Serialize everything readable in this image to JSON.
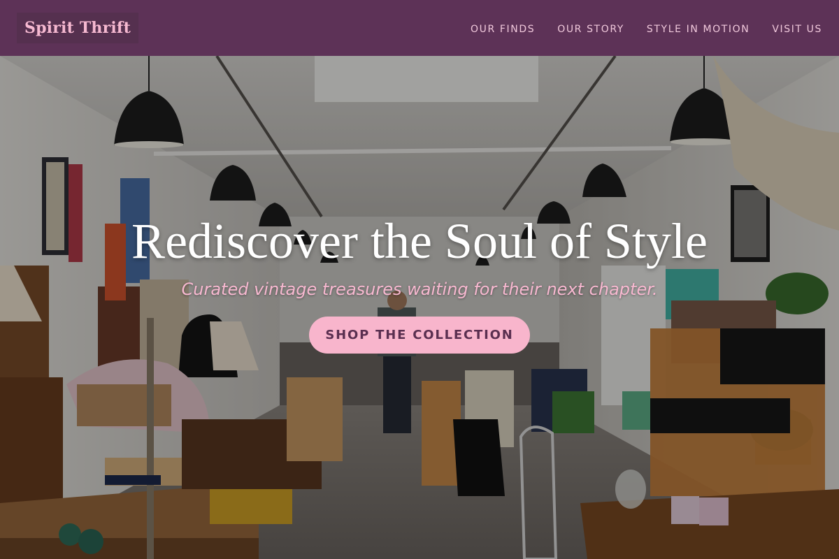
{
  "brand": {
    "name": "Spirit Thrift"
  },
  "nav": {
    "items": [
      {
        "label": "OUR FINDS"
      },
      {
        "label": "OUR STORY"
      },
      {
        "label": "STYLE IN MOTION"
      },
      {
        "label": "VISIT US"
      }
    ]
  },
  "hero": {
    "title": "Rediscover the Soul of Style",
    "subtitle": "Curated vintage treasures waiting for their next chapter.",
    "cta_label": "SHOP THE COLLECTION",
    "background_image": "thrift-store-interior-photo"
  },
  "colors": {
    "navbar_bg": "#5d3257",
    "brand_text": "#f6b9d1",
    "nav_text": "#f0c8db",
    "subtitle_text": "#f7b8d0",
    "cta_bg": "#f8b5cc",
    "cta_text": "#5a2f50"
  }
}
